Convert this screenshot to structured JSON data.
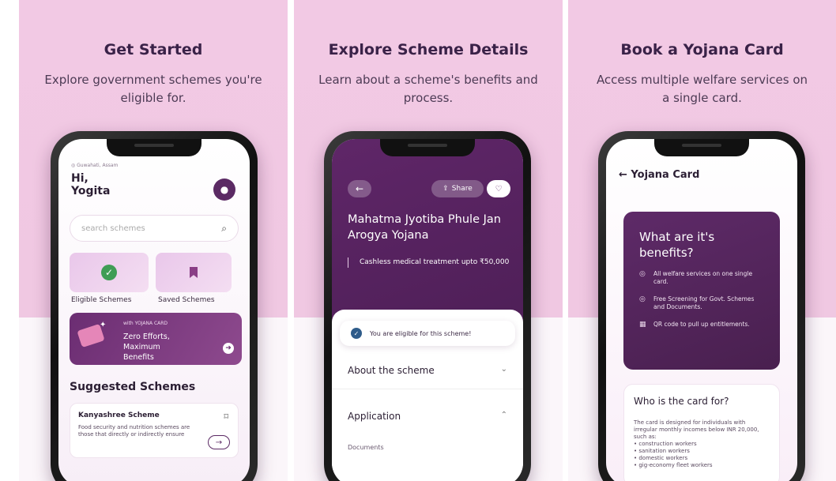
{
  "panels": [
    {
      "title": "Get Started",
      "subtitle": "Explore government schemes you're eligible for."
    },
    {
      "title": "Explore Scheme Details",
      "subtitle": "Learn about a scheme's benefits and process."
    },
    {
      "title": "Book a Yojana Card",
      "subtitle": "Access multiple welfare services on a single card."
    }
  ],
  "home": {
    "location": "Guwahati, Assam",
    "greeting": "Hi, Yogita",
    "search_placeholder": "search schemes",
    "tiles": [
      {
        "label": "Eligible Schemes",
        "icon": "check-circle-icon"
      },
      {
        "label": "Saved Schemes",
        "icon": "bookmark-icon"
      }
    ],
    "promo": {
      "tag": "with YOJANA CARD",
      "text": "Zero Efforts, Maximum Benefits"
    },
    "suggested_title": "Suggested Schemes",
    "card": {
      "title": "Kanyashree Scheme",
      "description": "Food security and nutrition schemes are those that directly or indirectly ensure"
    }
  },
  "scheme": {
    "share_label": "Share",
    "title": "Mahatma Jyotiba Phule Jan Arogya Yojana",
    "benefit": "Cashless medical treatment upto ₹50,000",
    "eligible_text": "You are eligible for this scheme!",
    "sections": [
      "About the scheme",
      "Application"
    ],
    "documents_label": "Documents"
  },
  "card": {
    "header": "Yojana Card",
    "benefits_title": "What are it's benefits?",
    "benefits": [
      "All welfare services on one single card.",
      "Free Screening for Govt. Schemes and Documents.",
      "QR code to pull up entitlements."
    ],
    "who_title": "Who is the card for?",
    "who_desc": "The card is designed for individuals with irregular monthly incomes below INR 20,000, such as:",
    "who_list": [
      "construction workers",
      "sanitation workers",
      "domestic workers",
      "gig-economy fleet workers"
    ]
  },
  "colors": {
    "brand_purple": "#5f2668",
    "panel_pink": "#f2c9e4",
    "success_green": "#3f9d55"
  }
}
